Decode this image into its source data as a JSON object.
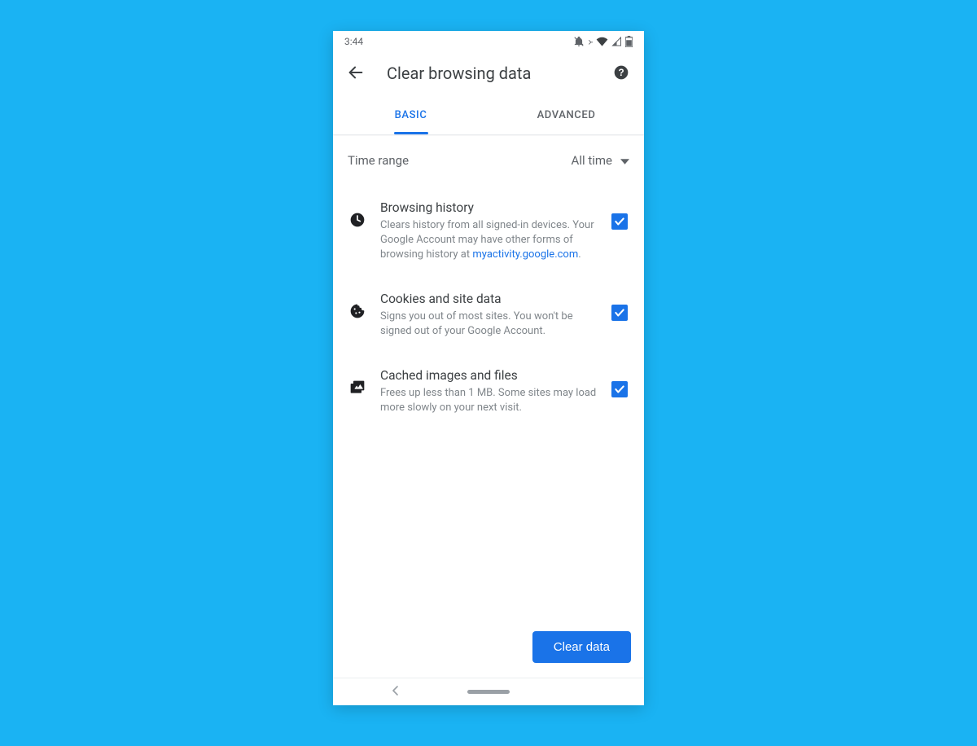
{
  "status": {
    "time": "3:44"
  },
  "header": {
    "title": "Clear browsing data"
  },
  "tabs": {
    "basic": "BASIC",
    "advanced": "ADVANCED"
  },
  "timeRange": {
    "label": "Time range",
    "value": "All time"
  },
  "options": [
    {
      "title": "Browsing history",
      "desc_before": "Clears history from all signed-in devices. Your Google Account may have other forms of browsing history at ",
      "link": "myactivity.google.com",
      "desc_after": ".",
      "checked": true
    },
    {
      "title": "Cookies and site data",
      "desc": "Signs you out of most sites. You won't be signed out of your Google Account.",
      "checked": true
    },
    {
      "title": "Cached images and files",
      "desc": "Frees up less than 1 MB. Some sites may load more slowly on your next visit.",
      "checked": true
    }
  ],
  "footer": {
    "clear": "Clear data"
  }
}
